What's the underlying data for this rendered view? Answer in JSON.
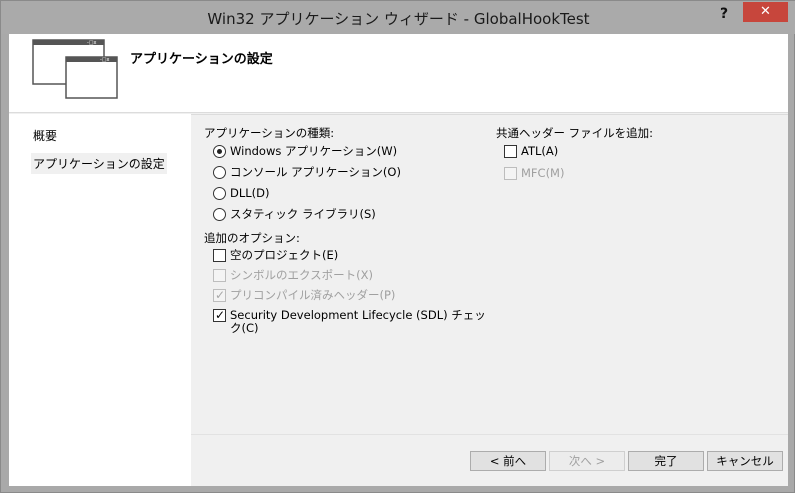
{
  "window": {
    "title": "Win32 アプリケーション ウィザード - GlobalHookTest",
    "help_glyph": "?",
    "close_glyph": "✕"
  },
  "header": {
    "title": "アプリケーションの設定"
  },
  "nav": {
    "items": [
      {
        "label": "概要"
      },
      {
        "label": "アプリケーションの設定"
      }
    ]
  },
  "app_type": {
    "label": "アプリケーションの種類:",
    "options": [
      {
        "label": "Windows アプリケーション(W)",
        "checked": true
      },
      {
        "label": "コンソール アプリケーション(O)",
        "checked": false
      },
      {
        "label": "DLL(D)",
        "checked": false
      },
      {
        "label": "スタティック ライブラリ(S)",
        "checked": false
      }
    ]
  },
  "additional_options": {
    "label": "追加のオプション:",
    "options": [
      {
        "label": "空のプロジェクト(E)",
        "checked": false,
        "enabled": true
      },
      {
        "label": "シンボルのエクスポート(X)",
        "checked": false,
        "enabled": false
      },
      {
        "label": "プリコンパイル済みヘッダー(P)",
        "checked": true,
        "enabled": false
      },
      {
        "label": "Security Development Lifecycle (SDL) チェッ",
        "label_line2": "ク(C)",
        "checked": true,
        "enabled": true
      }
    ]
  },
  "common_headers": {
    "label": "共通ヘッダー ファイルを追加:",
    "options": [
      {
        "label": "ATL(A)",
        "checked": false,
        "enabled": true
      },
      {
        "label": "MFC(M)",
        "checked": false,
        "enabled": false
      }
    ]
  },
  "buttons": {
    "prev": "< 前へ",
    "next": "次へ >",
    "finish": "完了",
    "cancel": "キャンセル"
  }
}
